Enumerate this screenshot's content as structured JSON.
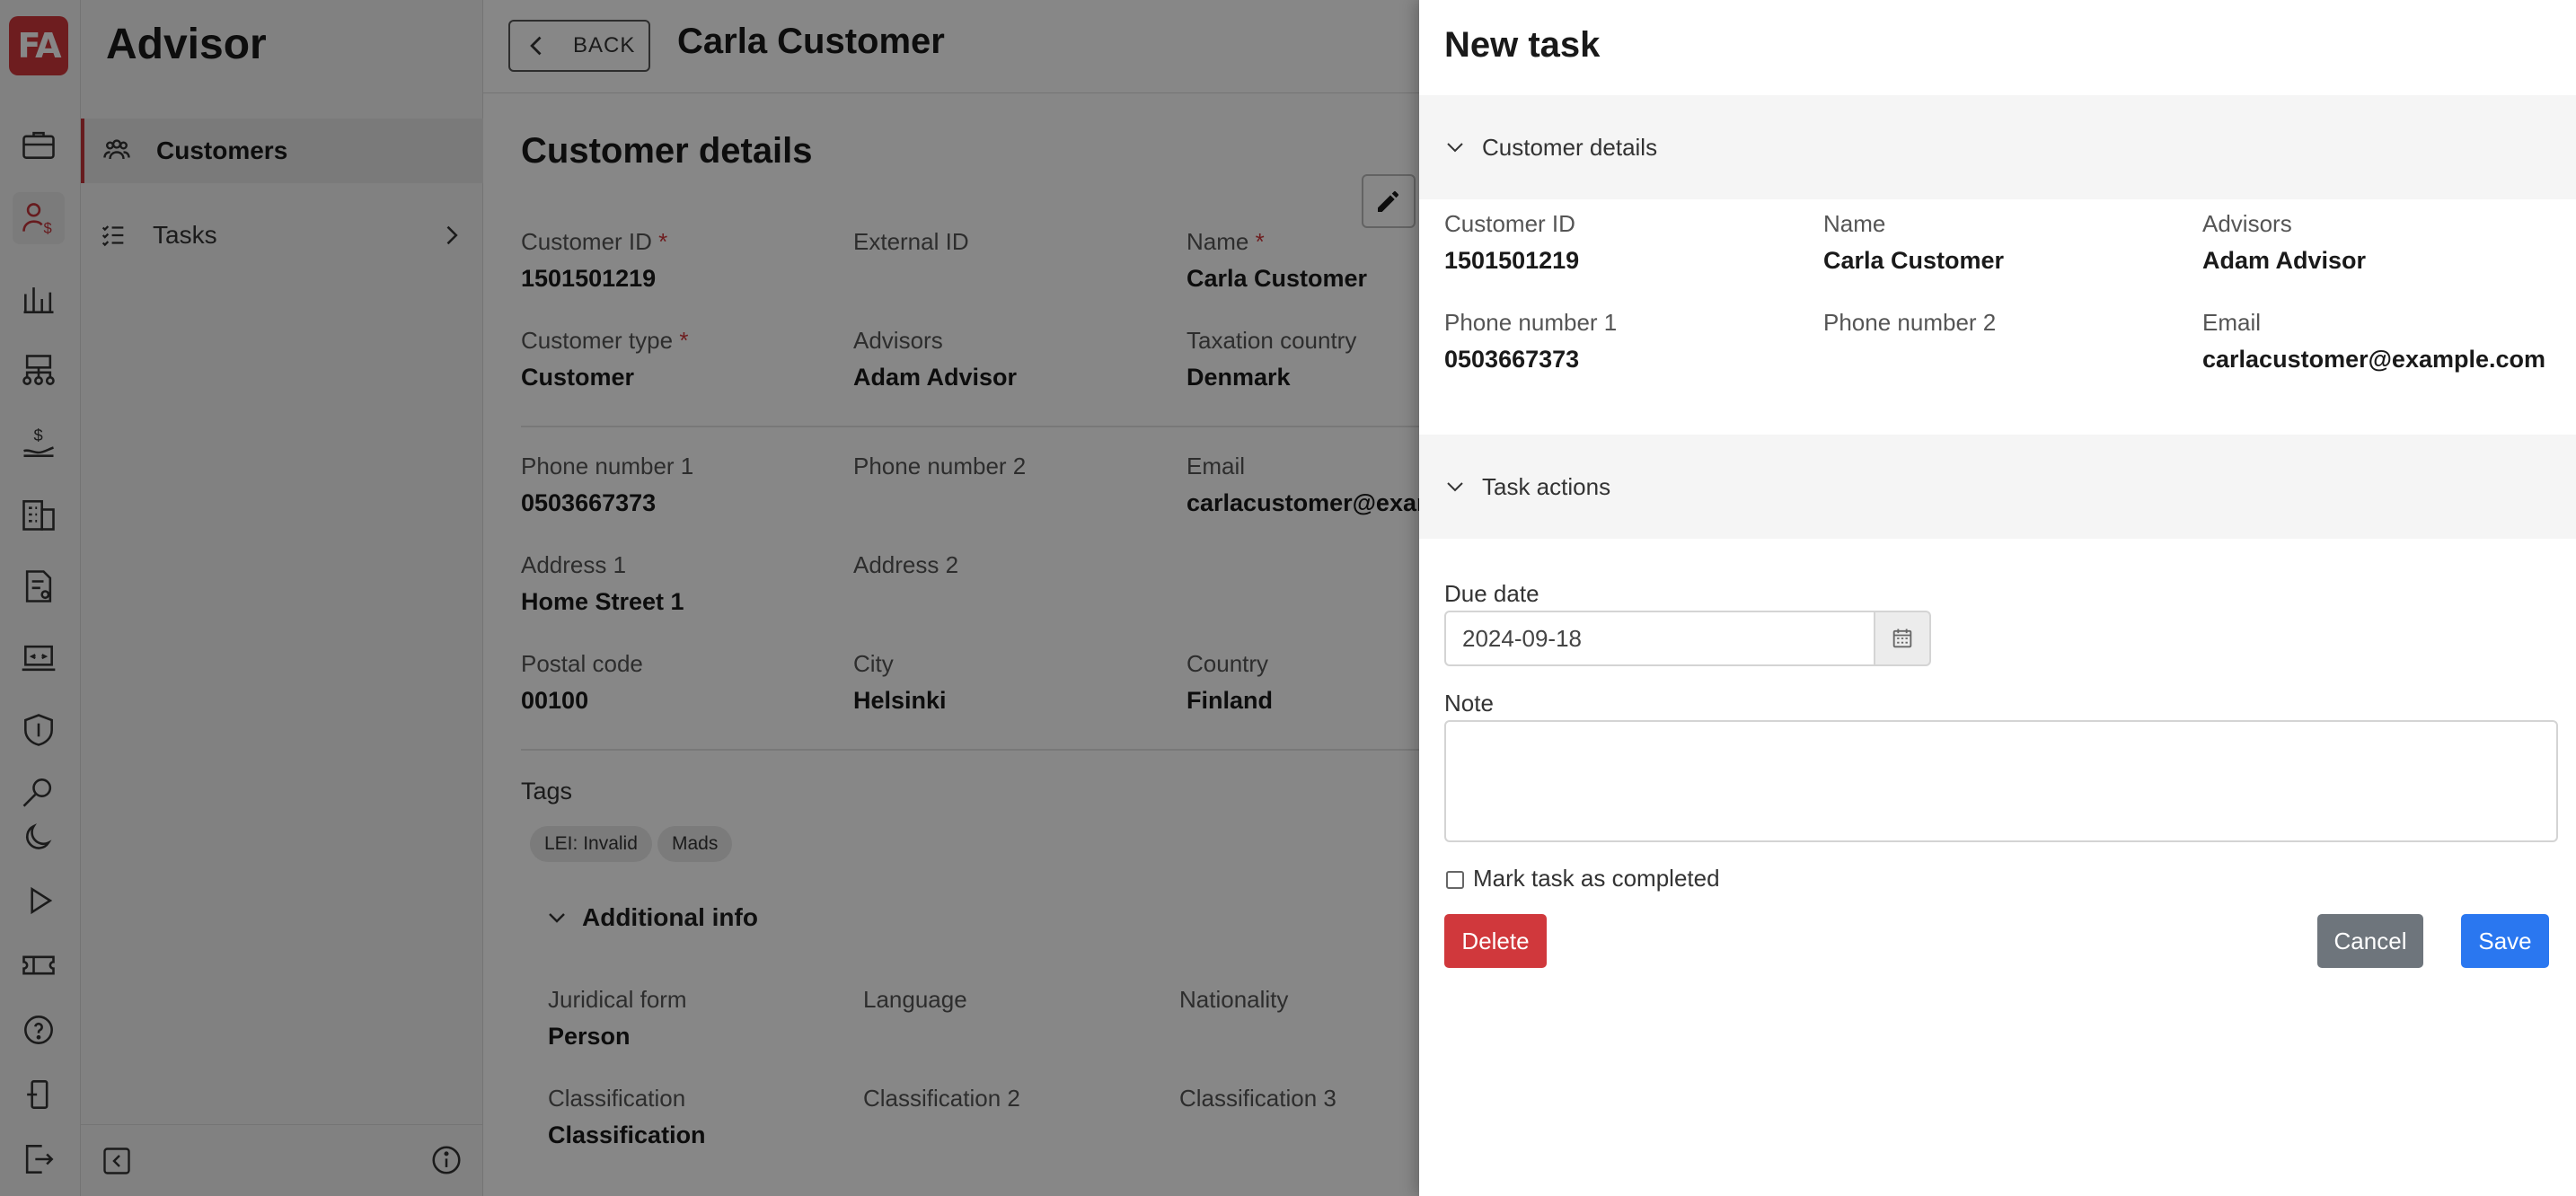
{
  "nav": {
    "app_title": "Advisor",
    "items": [
      {
        "label": "Customers",
        "icon": "users-icon"
      },
      {
        "label": "Tasks",
        "icon": "task-list-icon"
      }
    ],
    "accent": "#c2343a"
  },
  "logo": {
    "text": "FA",
    "color": "#d0383c"
  },
  "header": {
    "back_label": "BACK",
    "title": "Carla Customer"
  },
  "customer": {
    "section_title": "Customer details",
    "fields": {
      "customer_id": {
        "label": "Customer ID",
        "value": "1501501219"
      },
      "external_id": {
        "label": "External ID",
        "value": ""
      },
      "name": {
        "label": "Name",
        "value": "Carla Customer"
      },
      "customer_type": {
        "label": "Customer type",
        "value": "Customer"
      },
      "advisors": {
        "label": "Advisors",
        "value": "Adam Advisor"
      },
      "taxation_country": {
        "label": "Taxation country",
        "value": "Denmark"
      },
      "phone1": {
        "label": "Phone number 1",
        "value": "0503667373"
      },
      "phone2": {
        "label": "Phone number 2",
        "value": ""
      },
      "email": {
        "label": "Email",
        "value": "carlacustomer@exam"
      },
      "address1": {
        "label": "Address 1",
        "value": "Home Street 1"
      },
      "address2": {
        "label": "Address 2",
        "value": ""
      },
      "postal_code": {
        "label": "Postal code",
        "value": "00100"
      },
      "city": {
        "label": "City",
        "value": "Helsinki"
      },
      "country": {
        "label": "Country",
        "value": "Finland"
      }
    },
    "required_mark": "*",
    "tags_label": "Tags",
    "tags": [
      "LEI: Invalid",
      "Mads"
    ],
    "additional_info_label": "Additional info",
    "additional": {
      "juridical_form": {
        "label": "Juridical form",
        "value": "Person"
      },
      "language": {
        "label": "Language",
        "value": ""
      },
      "nationality": {
        "label": "Nationality",
        "value": ""
      },
      "classification": {
        "label": "Classification",
        "value": "Classification"
      },
      "classification2": {
        "label": "Classification 2",
        "value": ""
      },
      "classification3": {
        "label": "Classification 3",
        "value": ""
      }
    }
  },
  "drawer": {
    "title": "New task",
    "customer_section_label": "Customer details",
    "customer": {
      "customer_id": {
        "label": "Customer ID",
        "value": "1501501219"
      },
      "name": {
        "label": "Name",
        "value": "Carla Customer"
      },
      "advisors": {
        "label": "Advisors",
        "value": "Adam Advisor"
      },
      "phone1": {
        "label": "Phone number 1",
        "value": "0503667373"
      },
      "phone2": {
        "label": "Phone number 2",
        "value": ""
      },
      "email": {
        "label": "Email",
        "value": "carlacustomer@example.com"
      }
    },
    "task_section_label": "Task actions",
    "due_date_label": "Due date",
    "due_date_value": "2024-09-18",
    "note_label": "Note",
    "note_value": "",
    "completed_label": "Mark task as completed",
    "completed_checked": false,
    "delete_label": "Delete",
    "cancel_label": "Cancel",
    "save_label": "Save",
    "colors": {
      "delete": "#d0383c",
      "cancel": "#6e757c",
      "save": "#2a77f0"
    }
  }
}
